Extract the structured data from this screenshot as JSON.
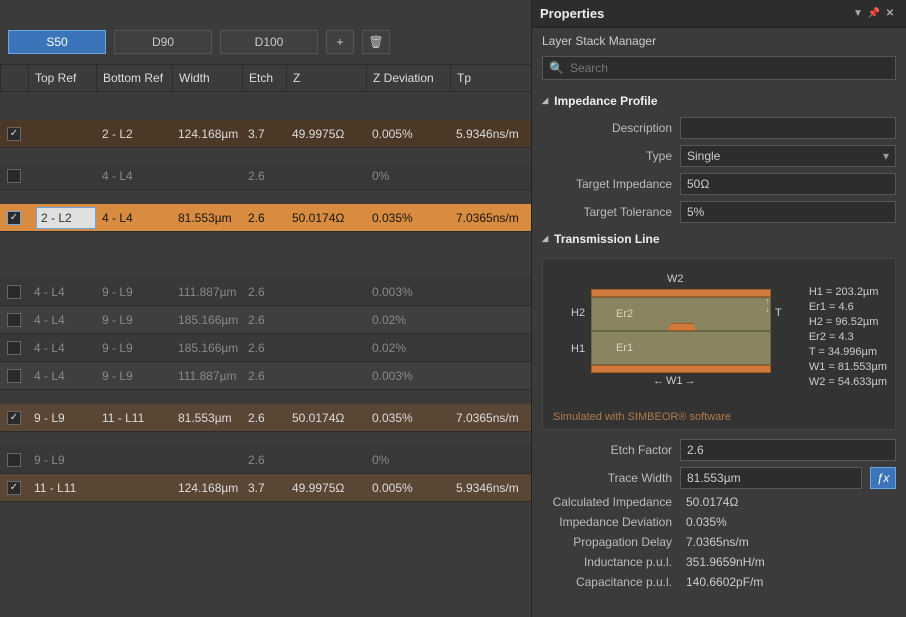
{
  "profile_tabs": {
    "s50": "S50",
    "d90": "D90",
    "d100": "D100"
  },
  "table": {
    "headers": {
      "top": "Top Ref",
      "bot": "Bottom Ref",
      "width": "Width",
      "etch": "Etch",
      "z": "Z",
      "zdev": "Z Deviation",
      "tp": "Tp"
    },
    "rows": [
      {
        "chk": true,
        "cls": "row-brown",
        "top": "",
        "bot": "2 - L2",
        "width": "124.168µm",
        "etch": "3.7",
        "z": "49.9975Ω",
        "zdev": "0.005%",
        "tp": "5.9346ns/m"
      },
      {
        "chk": false,
        "cls": "row-dim",
        "top": "",
        "bot": "4 - L4",
        "width": "",
        "etch": "2.6",
        "z": "",
        "zdev": "0%",
        "tp": ""
      },
      {
        "chk": true,
        "cls": "row-sel",
        "top": "2 - L2",
        "bot": "4 - L4",
        "width": "81.553µm",
        "etch": "2.6",
        "z": "50.0174Ω",
        "zdev": "0.035%",
        "tp": "7.0365ns/m"
      },
      {
        "chk": false,
        "cls": "row-dim",
        "top": "4 - L4",
        "bot": "9 - L9",
        "width": "111.887µm",
        "etch": "2.6",
        "z": "",
        "zdev": "0.003%",
        "tp": ""
      },
      {
        "chk": false,
        "cls": "row-dim-light",
        "top": "4 - L4",
        "bot": "9 - L9",
        "width": "185.166µm",
        "etch": "2.6",
        "z": "",
        "zdev": "0.02%",
        "tp": ""
      },
      {
        "chk": false,
        "cls": "row-dim",
        "top": "4 - L4",
        "bot": "9 - L9",
        "width": "185.166µm",
        "etch": "2.6",
        "z": "",
        "zdev": "0.02%",
        "tp": ""
      },
      {
        "chk": false,
        "cls": "row-dim-light",
        "top": "4 - L4",
        "bot": "9 - L9",
        "width": "111.887µm",
        "etch": "2.6",
        "z": "",
        "zdev": "0.003%",
        "tp": ""
      },
      {
        "chk": true,
        "cls": "row-brown-light",
        "top": "9 - L9",
        "bot": "11 - L11",
        "width": "81.553µm",
        "etch": "2.6",
        "z": "50.0174Ω",
        "zdev": "0.035%",
        "tp": "7.0365ns/m"
      },
      {
        "chk": false,
        "cls": "row-dim",
        "top": "9 - L9",
        "bot": "",
        "width": "",
        "etch": "2.6",
        "z": "",
        "zdev": "0%",
        "tp": ""
      },
      {
        "chk": true,
        "cls": "row-brown-light",
        "top": "11 - L11",
        "bot": "",
        "width": "124.168µm",
        "etch": "3.7",
        "z": "49.9975Ω",
        "zdev": "0.005%",
        "tp": "5.9346ns/m"
      }
    ]
  },
  "panel": {
    "title": "Properties",
    "subtitle": "Layer Stack Manager",
    "search_placeholder": "Search"
  },
  "sections": {
    "impedance": "Impedance Profile",
    "tline": "Transmission Line"
  },
  "impedance": {
    "description_label": "Description",
    "description": "",
    "type_label": "Type",
    "type": "Single",
    "target_z_label": "Target Impedance",
    "target_z": "50Ω",
    "target_tol_label": "Target Tolerance",
    "target_tol": "5%"
  },
  "tline": {
    "w2_label": "W2",
    "w1_label": "W1",
    "er2_label": "Er2",
    "er1_label": "Er1",
    "h2_label": "H2",
    "h1_label": "H1",
    "t_label": "T",
    "vals": {
      "h1": "H1 = 203.2µm",
      "er1": "Er1 = 4.6",
      "h2": "H2 = 96.52µm",
      "er2": "Er2 = 4.3",
      "t": "T = 34.996µm",
      "w1": "W1 = 81.553µm",
      "w2": "W2 = 54.633µm"
    },
    "sim_note": "Simulated with SIMBEOR® software",
    "etch_label": "Etch Factor",
    "etch": "2.6",
    "trace_w_label": "Trace Width",
    "trace_w": "81.553µm",
    "calc_z_label": "Calculated Impedance",
    "calc_z": "50.0174Ω",
    "z_dev_label": "Impedance Deviation",
    "z_dev": "0.035%",
    "pd_label": "Propagation Delay",
    "pd": "7.0365ns/m",
    "ind_label": "Inductance p.u.l.",
    "ind": "351.9659nH/m",
    "cap_label": "Capacitance p.u.l.",
    "cap": "140.6602pF/m"
  }
}
